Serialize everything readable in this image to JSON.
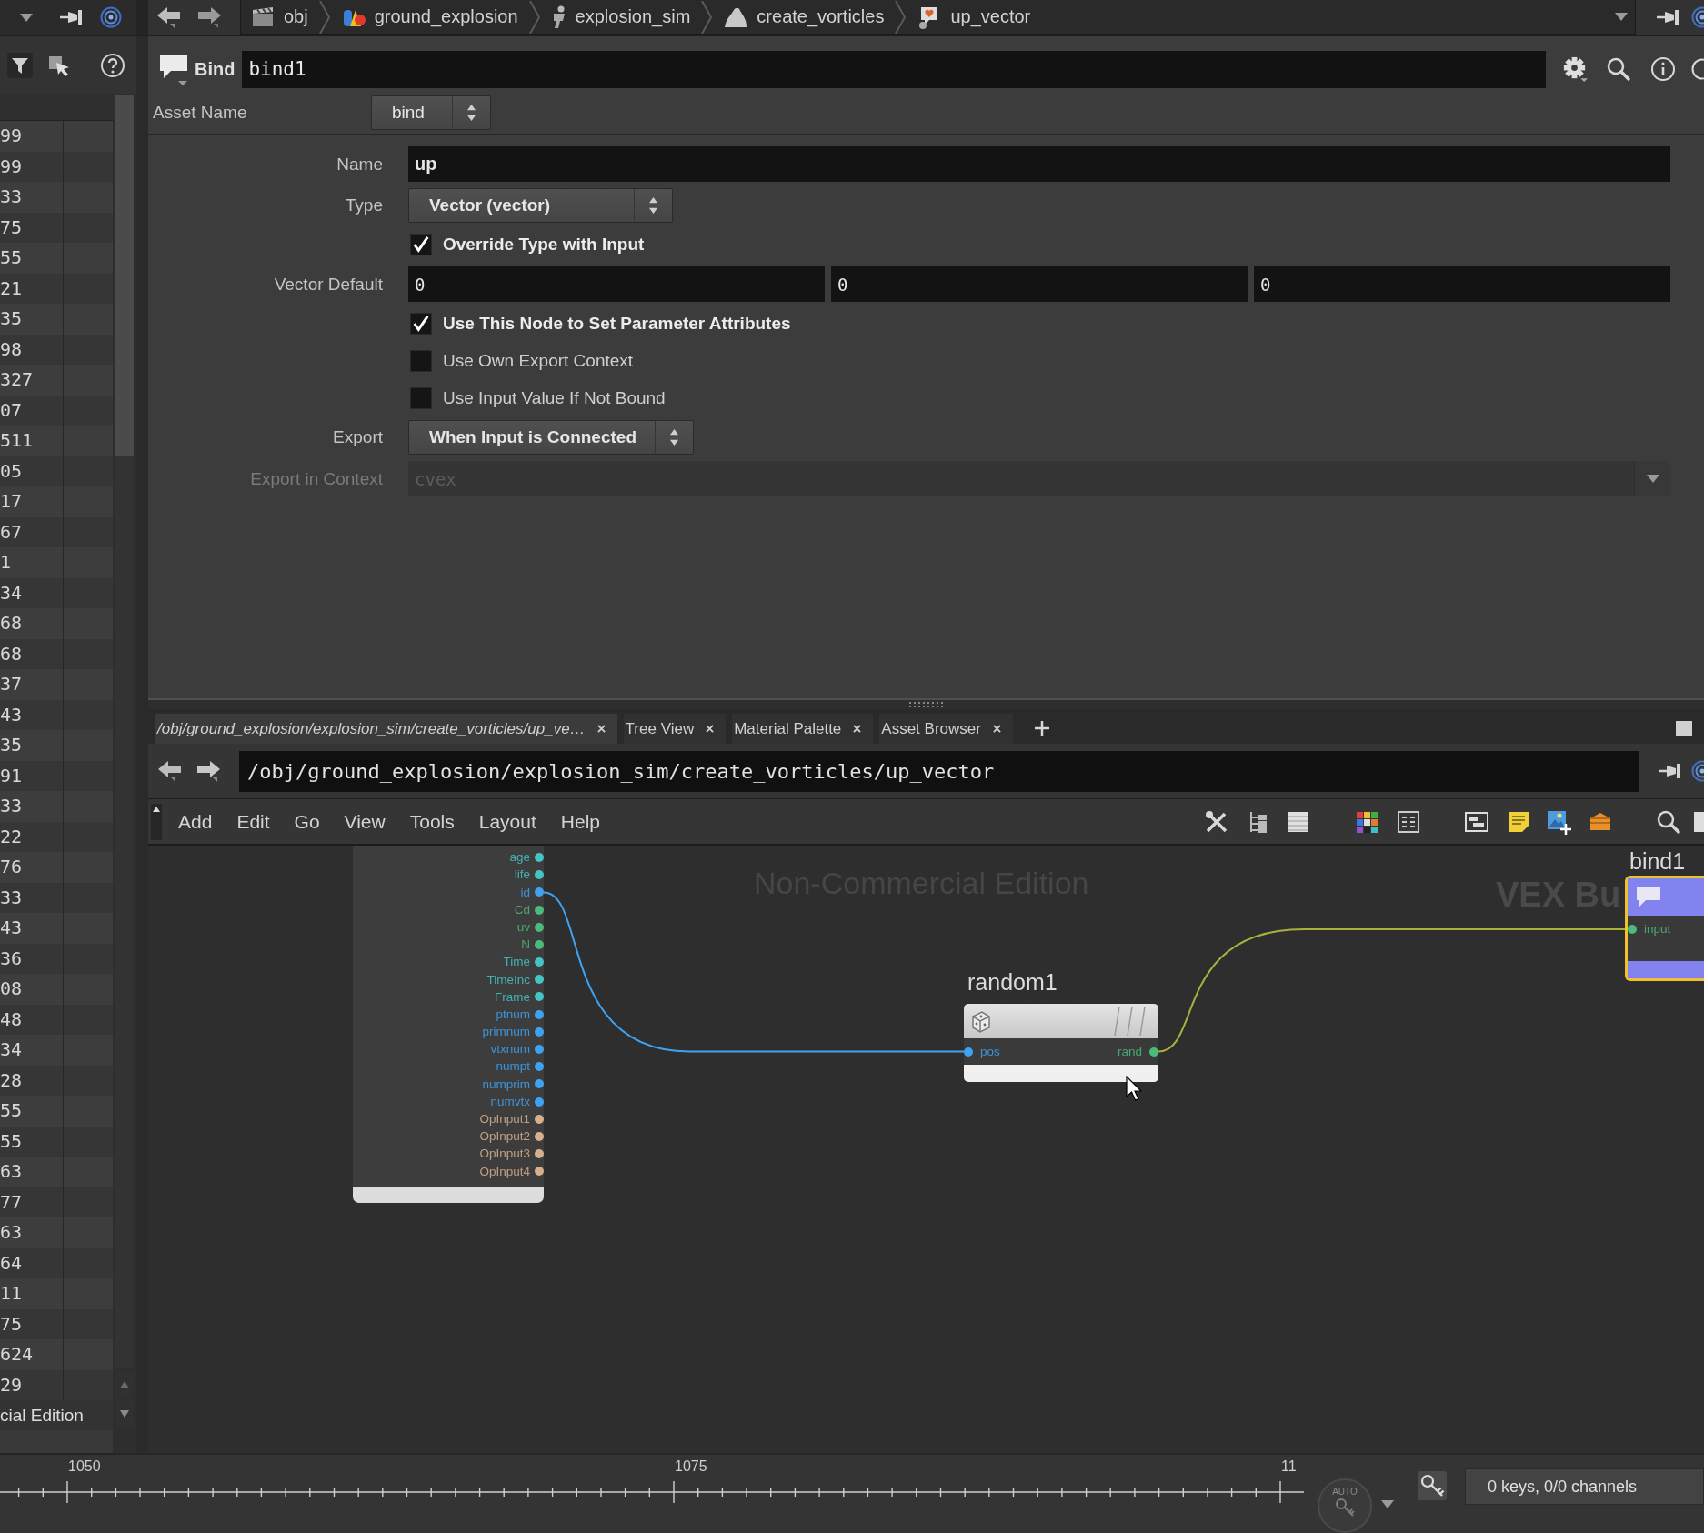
{
  "top_bar": {
    "crumbs": [
      {
        "kind": "object",
        "label": "obj"
      },
      {
        "kind": "geometry",
        "label": "ground_explosion"
      },
      {
        "kind": "dop",
        "label": "explosion_sim"
      },
      {
        "kind": "sop",
        "label": "create_vorticles"
      },
      {
        "kind": "vop",
        "label": "up_vector"
      }
    ]
  },
  "list_panel": {
    "values": [
      "99",
      "99",
      "33",
      "75",
      "55",
      "21",
      "35",
      "98",
      "327",
      "07",
      "511",
      "05",
      "17",
      "67",
      "1",
      "34",
      "68",
      "68",
      "37",
      "43",
      "35",
      "91",
      "33",
      "22",
      "76",
      "33",
      "43",
      "36",
      "08",
      "48",
      "34",
      "28",
      "55",
      "55",
      "63",
      "77",
      "63",
      "64",
      "11",
      "75",
      "624",
      "29"
    ],
    "footer": "cial Edition"
  },
  "parameters": {
    "node_type": "Bind",
    "node_name": "bind1",
    "asset_label": "Asset Name",
    "asset_value": "bind",
    "fields": [
      {
        "kind": "text",
        "label": "Name",
        "value": "up",
        "modified": true,
        "disabled": false
      },
      {
        "kind": "menu",
        "label": "Type",
        "value": "Vector (vector)",
        "modified": true,
        "disabled": false
      },
      {
        "kind": "toggle",
        "label": "Override Type with Input",
        "checked": true,
        "modified": true,
        "disabled": false
      },
      {
        "kind": "vector",
        "label": "Vector Default",
        "values": [
          "0",
          "0",
          "0"
        ],
        "modified": false,
        "disabled": false
      },
      {
        "kind": "toggle",
        "label": "Use This Node to Set Parameter Attributes",
        "checked": true,
        "modified": true,
        "disabled": false
      },
      {
        "kind": "toggle",
        "label": "Use Own Export Context",
        "checked": false,
        "modified": false,
        "disabled": false
      },
      {
        "kind": "toggle",
        "label": "Use Input Value If Not Bound",
        "checked": false,
        "modified": false,
        "disabled": false
      },
      {
        "kind": "menu",
        "label": "Export",
        "value": "When Input is Connected",
        "modified": true,
        "disabled": false
      },
      {
        "kind": "combo",
        "label": "Export in Context",
        "value": "cvex",
        "modified": false,
        "disabled": true
      }
    ]
  },
  "network": {
    "tabs": [
      {
        "label": "/obj/ground_explosion/explosion_sim/create_vorticles/up_ve…",
        "selected": true
      },
      {
        "label": "Tree View",
        "selected": false
      },
      {
        "label": "Material Palette",
        "selected": false
      },
      {
        "label": "Asset Browser",
        "selected": false
      }
    ],
    "path": "/obj/ground_explosion/explosion_sim/create_vorticles/up_vector",
    "menu": [
      "Add",
      "Edit",
      "Go",
      "View",
      "Tools",
      "Layout",
      "Help"
    ],
    "edition_label": "Non-Commercial Edition",
    "context_label": "VEX Bu",
    "nodes": [
      {
        "kind": "globals",
        "selected": false,
        "outputs": [
          {
            "name": "age",
            "color": "#45c4c6"
          },
          {
            "name": "life",
            "color": "#45c4c6"
          },
          {
            "name": "id",
            "color": "#3ea2f2"
          },
          {
            "name": "Cd",
            "color": "#4cbb7a"
          },
          {
            "name": "uv",
            "color": "#4cbb7a"
          },
          {
            "name": "N",
            "color": "#4cbb7a"
          },
          {
            "name": "Time",
            "color": "#45c4c6"
          },
          {
            "name": "TimeInc",
            "color": "#45c4c6"
          },
          {
            "name": "Frame",
            "color": "#45c4c6"
          },
          {
            "name": "ptnum",
            "color": "#3ea2f2"
          },
          {
            "name": "primnum",
            "color": "#3ea2f2"
          },
          {
            "name": "vtxnum",
            "color": "#3ea2f2"
          },
          {
            "name": "numpt",
            "color": "#3ea2f2"
          },
          {
            "name": "numprim",
            "color": "#3ea2f2"
          },
          {
            "name": "numvtx",
            "color": "#3ea2f2"
          },
          {
            "name": "OpInput1",
            "color": "#d6b08e"
          },
          {
            "name": "OpInput2",
            "color": "#d6b08e"
          },
          {
            "name": "OpInput3",
            "color": "#d6b08e"
          },
          {
            "name": "OpInput4",
            "color": "#d6b08e"
          }
        ]
      },
      {
        "kind": "random",
        "name": "random1",
        "selected": false,
        "inputs": [
          {
            "name": "pos",
            "color": "#3ea2f2"
          }
        ],
        "outputs": [
          {
            "name": "rand",
            "color": "#4cbb7a"
          }
        ]
      },
      {
        "kind": "bind",
        "name": "bind1",
        "selected": true,
        "inputs": [
          {
            "name": "input",
            "color": "#4cbb7a"
          }
        ]
      }
    ],
    "wires": [
      {
        "color": "#3ea2f2"
      },
      {
        "color": "#a9b13c"
      }
    ]
  },
  "timeline": {
    "frame_labels": [
      "1050",
      "1075",
      "11"
    ],
    "auto_label": "AUTO",
    "keys_status": "0 keys, 0/0 channels"
  }
}
